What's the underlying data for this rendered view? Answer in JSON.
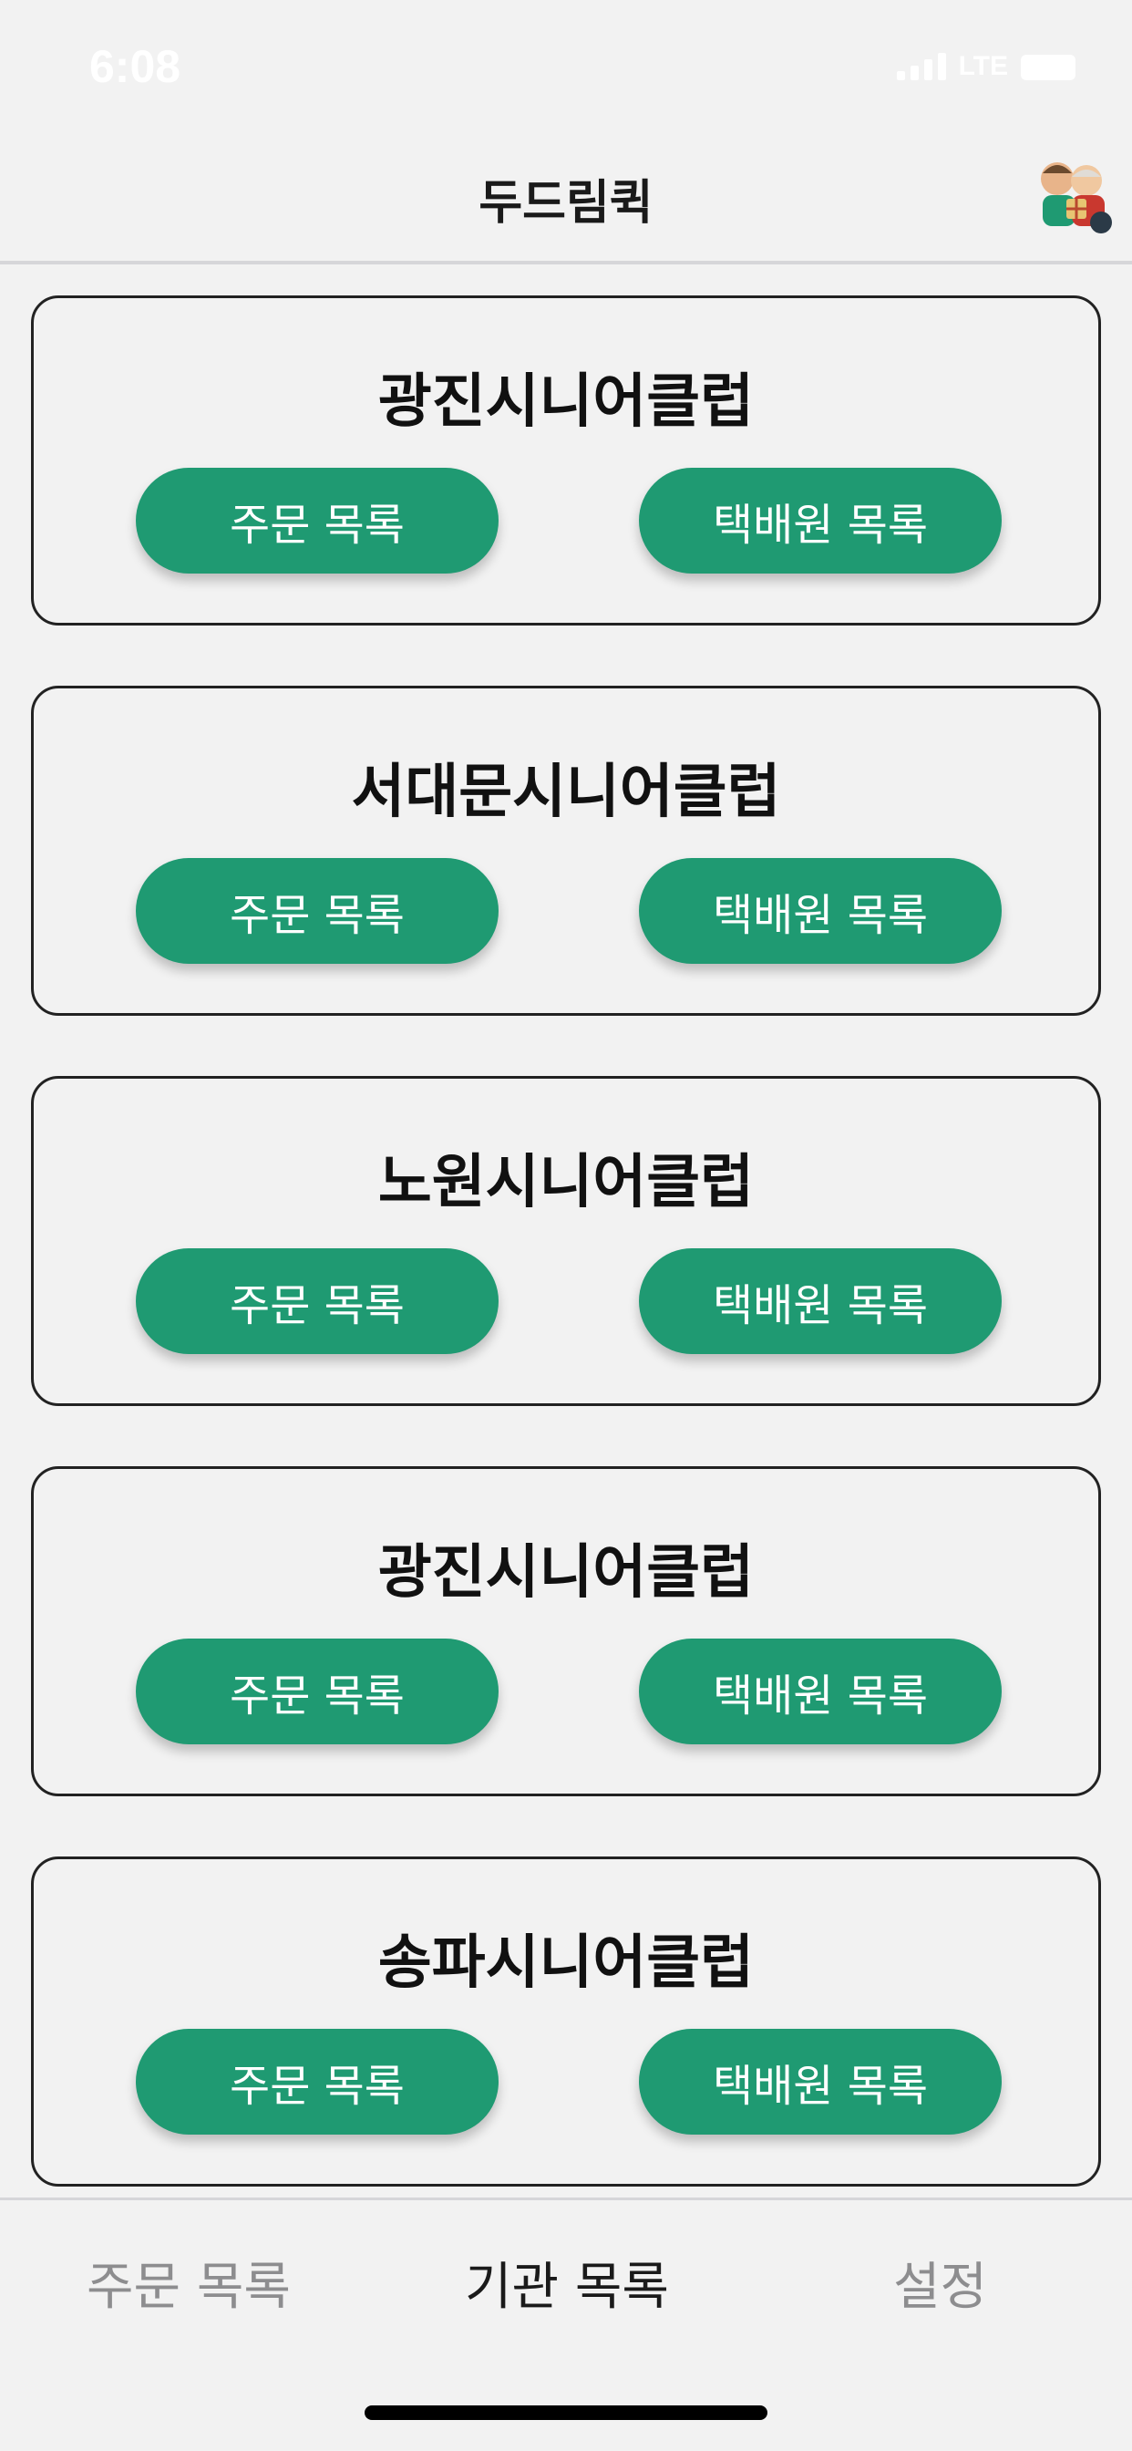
{
  "status_bar": {
    "time": "6:08",
    "network": "LTE"
  },
  "header": {
    "title": "두드림퀵"
  },
  "agencies": [
    {
      "name": "광진시니어클럽",
      "order_button": "주문 목록",
      "courier_button": "택배원 목록"
    },
    {
      "name": "서대문시니어클럽",
      "order_button": "주문 목록",
      "courier_button": "택배원 목록"
    },
    {
      "name": "노원시니어클럽",
      "order_button": "주문 목록",
      "courier_button": "택배원 목록"
    },
    {
      "name": "광진시니어클럽",
      "order_button": "주문 목록",
      "courier_button": "택배원 목록"
    },
    {
      "name": "송파시니어클럽",
      "order_button": "주문 목록",
      "courier_button": "택배원 목록"
    }
  ],
  "tabs": [
    {
      "label": "주문 목록",
      "active": false
    },
    {
      "label": "기관 목록",
      "active": true
    },
    {
      "label": "설정",
      "active": false
    }
  ],
  "colors": {
    "accent": "#1f9a72",
    "background": "#f2f2f2"
  }
}
